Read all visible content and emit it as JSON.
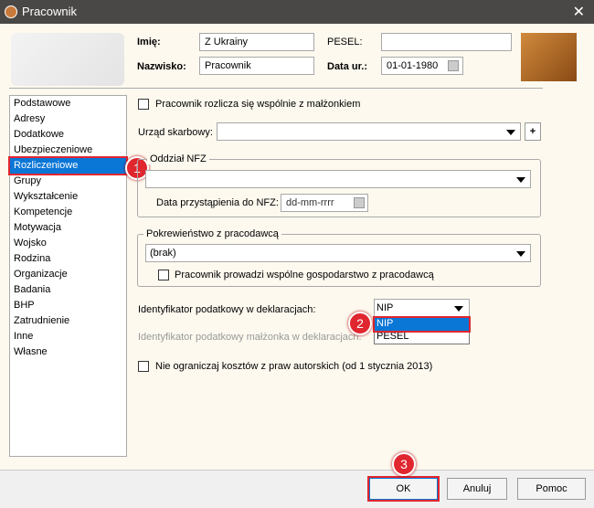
{
  "window": {
    "title": "Pracownik"
  },
  "header": {
    "imie_label": "Imię:",
    "imie_value": "Z Ukrainy",
    "nazwisko_label": "Nazwisko:",
    "nazwisko_value": "Pracownik",
    "pesel_label": "PESEL:",
    "pesel_value": "",
    "data_label": "Data ur.:",
    "data_value": "01-01-1980"
  },
  "sidebar": {
    "items": [
      "Podstawowe",
      "Adresy",
      "Dodatkowe",
      "Ubezpieczeniowe",
      "Rozliczeniowe",
      "Grupy",
      "Wykształcenie",
      "Kompetencje",
      "Motywacja",
      "Wojsko",
      "Rodzina",
      "Organizacje",
      "Badania",
      "BHP",
      "Zatrudnienie",
      "Inne",
      "Własne"
    ],
    "selected": "Rozliczeniowe"
  },
  "main": {
    "wspolnie": "Pracownik rozlicza się wspólnie z małżonkiem",
    "urzad_label": "Urząd skarbowy:",
    "urzad_value": "",
    "plus": "+",
    "nfz_legend": "Oddział NFZ",
    "nfz_value": "",
    "nfz_date_label": "Data przystąpienia do NFZ:",
    "nfz_date_placeholder": "dd-mm-rrrr",
    "pokrew_legend": "Pokrewieństwo z pracodawcą",
    "pokrew_value": "(brak)",
    "gospodarstwo": "Pracownik prowadzi wspólne gospodarstwo z pracodawcą",
    "ident_label": "Identyfikator podatkowy w deklaracjach:",
    "ident_value": "NIP",
    "ident_options": [
      "NIP",
      "PESEL"
    ],
    "ident_malz_label": "Identyfikator podatkowy małżonka w deklaracjach:",
    "koszty": "Nie ograniczaj kosztów z praw autorskich (od 1 stycznia 2013)"
  },
  "badges": [
    "1",
    "2",
    "3"
  ],
  "buttons": {
    "ok": "OK",
    "cancel": "Anuluj",
    "help": "Pomoc"
  }
}
